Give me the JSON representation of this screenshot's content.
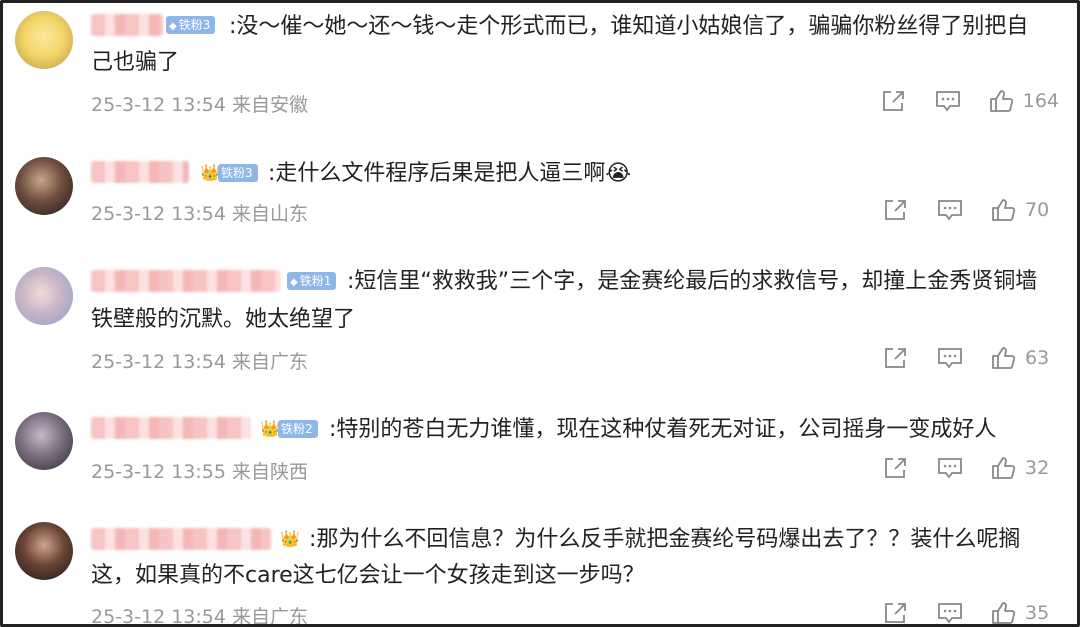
{
  "comments": [
    {
      "badge": "铁粉3",
      "text_lines": [
        ":没～催～她～还～钱～走个形式而已，谁知道小姑娘信了，骗骗你粉丝得了别把自",
        "己也骗了"
      ],
      "meta": "25-3-12 13:54 来自安徽",
      "likes": "164"
    },
    {
      "badge": "铁粉3",
      "text_lines": [
        ":走什么文件程序后果是把人逼三啊😭"
      ],
      "meta": "25-3-12 13:54 来自山东",
      "likes": "70"
    },
    {
      "badge": "铁粉1",
      "text_lines": [
        ":短信里“救救我”三个字，是金赛纶最后的求救信号，却撞上金秀贤铜墙",
        "铁壁般的沉默。她太绝望了"
      ],
      "meta": "25-3-12 13:54 来自广东",
      "likes": "63"
    },
    {
      "badge": "铁粉2",
      "text_lines": [
        ":特别的苍白无力谁懂，现在这种仗着死无对证，公司摇身一变成好人"
      ],
      "meta": "25-3-12 13:55 来自陕西",
      "likes": "32"
    },
    {
      "badge": "",
      "text_lines": [
        ":那为什么不回信息？为什么反手就把金赛纶号码爆出去了？？装什么呢搁",
        "这，如果真的不care这七亿会让一个女孩走到这一步吗？"
      ],
      "meta": "25-3-12 13:54 来自广东",
      "likes": "35"
    }
  ],
  "icons": {
    "share": "share-icon",
    "comment": "comment-icon",
    "like": "like-icon",
    "crown": "crown-icon",
    "fan_gem": "diamond-icon"
  },
  "colors": {
    "text": "#222222",
    "meta": "#999999",
    "badge": "#8fb6e8",
    "frame": "#222222"
  }
}
